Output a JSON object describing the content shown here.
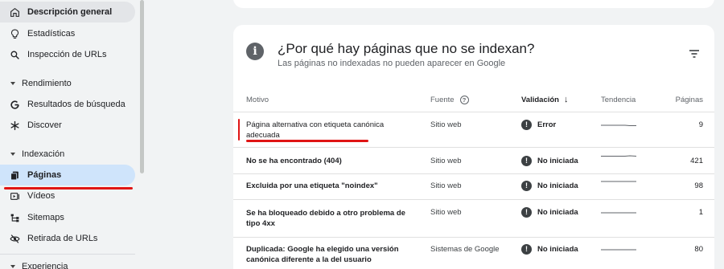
{
  "sidebar": {
    "items": [
      {
        "label": "Descripción general"
      },
      {
        "label": "Estadísticas"
      },
      {
        "label": "Inspección de URLs"
      },
      {
        "label": "Resultados de búsqueda"
      },
      {
        "label": "Discover"
      },
      {
        "label": "Páginas"
      },
      {
        "label": "Vídeos"
      },
      {
        "label": "Sitemaps"
      },
      {
        "label": "Retirada de URLs"
      }
    ],
    "sections": [
      {
        "label": "Rendimiento"
      },
      {
        "label": "Indexación"
      },
      {
        "label": "Experiencia"
      }
    ]
  },
  "card": {
    "title": "¿Por qué hay páginas que no se indexan?",
    "subtitle": "Las páginas no indexadas no pueden aparecer en Google",
    "info_glyph": "i"
  },
  "table": {
    "headers": {
      "motivo": "Motivo",
      "fuente": "Fuente",
      "validacion": "Validación",
      "tendencia": "Tendencia",
      "paginas": "Páginas"
    },
    "rows": [
      {
        "motivo": "Página alternativa con etiqueta canónica adecuada",
        "fuente": "Sitio web",
        "validacion": "Error",
        "paginas": "9"
      },
      {
        "motivo": "No se ha encontrado (404)",
        "fuente": "Sitio web",
        "validacion": "No iniciada",
        "paginas": "421"
      },
      {
        "motivo": "Excluida por una etiqueta \"noindex\"",
        "fuente": "Sitio web",
        "validacion": "No iniciada",
        "paginas": "98"
      },
      {
        "motivo": "Se ha bloqueado debido a otro problema de tipo 4xx",
        "fuente": "Sitio web",
        "validacion": "No iniciada",
        "paginas": "1"
      },
      {
        "motivo": "Duplicada: Google ha elegido una versión canónica diferente a la del usuario",
        "fuente": "Sistemas de Google",
        "validacion": "No iniciada",
        "paginas": "80"
      }
    ],
    "status_glyph": "!"
  },
  "colors": {
    "active_nav": "#cfe4fb",
    "annotation_red": "#e01515"
  }
}
